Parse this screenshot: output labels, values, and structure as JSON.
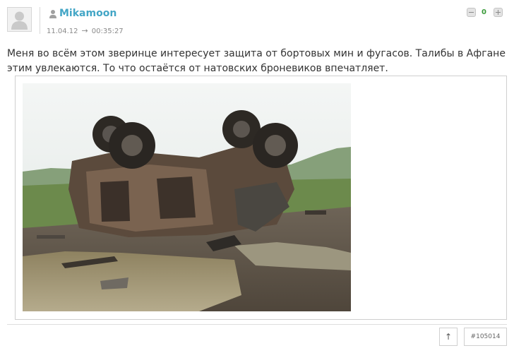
{
  "comment": {
    "username": "Mikamoon",
    "date": "11.04.12",
    "arrow": "→",
    "time": "00:35:27",
    "score": "0",
    "text": "Меня во всём этом зверинце интересует защита от бортовых мин и фугасов. Талибы в Афгане этим увлекаются. То что остаётся от натовских броневиков впечатляет.",
    "image_alt": "overturned destroyed armored vehicle",
    "up_label": "↑",
    "comment_id": "#105014"
  },
  "icons": {
    "avatar": "avatar-placeholder-icon",
    "user": "user-icon",
    "vote_down": "minus-icon",
    "vote_up": "plus-icon"
  },
  "colors": {
    "username": "#43a6c6",
    "score": "#3a9b3a",
    "text": "#333333",
    "meta": "#8a8a8a"
  }
}
